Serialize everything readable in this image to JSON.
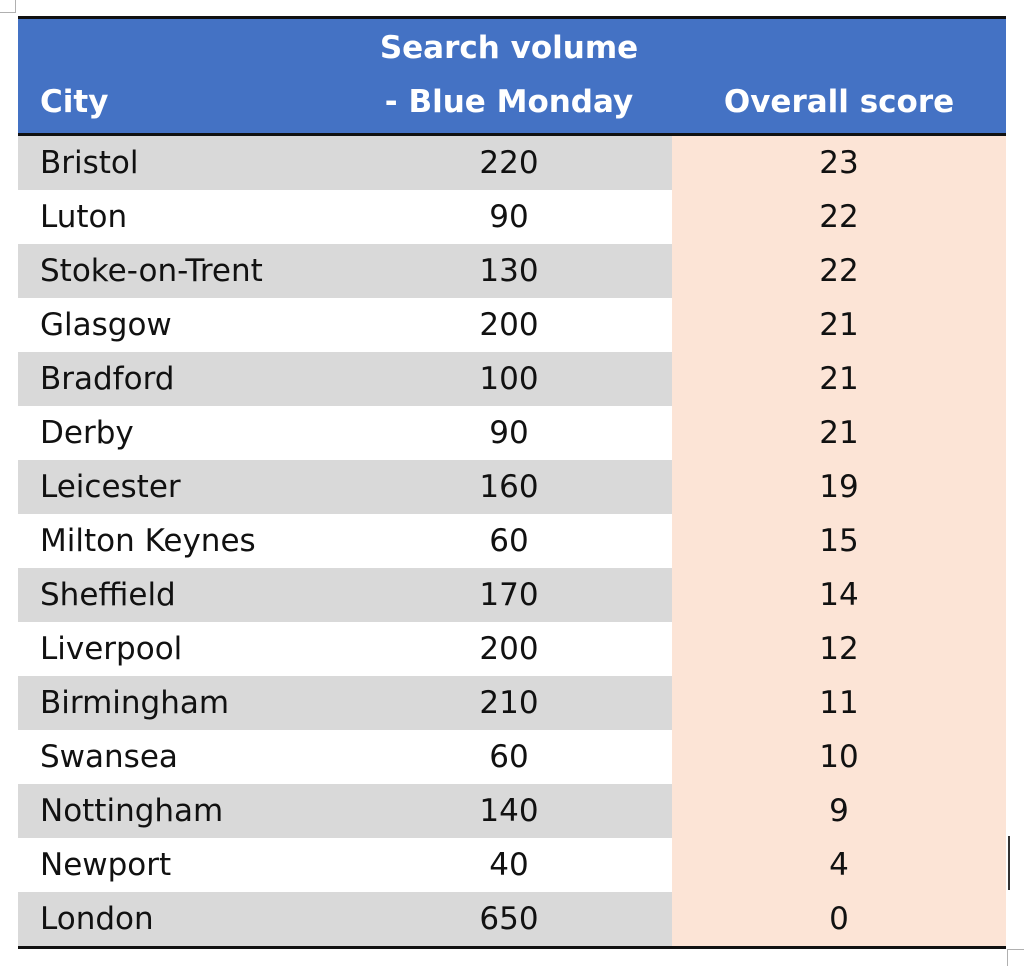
{
  "table": {
    "headers": {
      "city": "City",
      "search_volume_line1": "Search volume",
      "search_volume_line2": "- Blue Monday",
      "overall_score": "Overall score"
    },
    "rows": [
      {
        "city": "Bristol",
        "search_volume": "220",
        "overall_score": "23"
      },
      {
        "city": "Luton",
        "search_volume": "90",
        "overall_score": "22"
      },
      {
        "city": "Stoke-on-Trent",
        "search_volume": "130",
        "overall_score": "22"
      },
      {
        "city": "Glasgow",
        "search_volume": "200",
        "overall_score": "21"
      },
      {
        "city": "Bradford",
        "search_volume": "100",
        "overall_score": "21"
      },
      {
        "city": "Derby",
        "search_volume": "90",
        "overall_score": "21"
      },
      {
        "city": "Leicester",
        "search_volume": "160",
        "overall_score": "19"
      },
      {
        "city": "Milton Keynes",
        "search_volume": "60",
        "overall_score": "15"
      },
      {
        "city": "Sheffield",
        "search_volume": "170",
        "overall_score": "14"
      },
      {
        "city": "Liverpool",
        "search_volume": "200",
        "overall_score": "12"
      },
      {
        "city": "Birmingham",
        "search_volume": "210",
        "overall_score": "11"
      },
      {
        "city": "Swansea",
        "search_volume": "60",
        "overall_score": "10"
      },
      {
        "city": "Nottingham",
        "search_volume": "140",
        "overall_score": "9"
      },
      {
        "city": "Newport",
        "search_volume": "40",
        "overall_score": "4"
      },
      {
        "city": "London",
        "search_volume": "650",
        "overall_score": "0"
      }
    ]
  },
  "colors": {
    "header_bg": "#4472c4",
    "header_text": "#ffffff",
    "band_gray": "#d9d9d9",
    "score_column_bg": "#fce4d6"
  }
}
